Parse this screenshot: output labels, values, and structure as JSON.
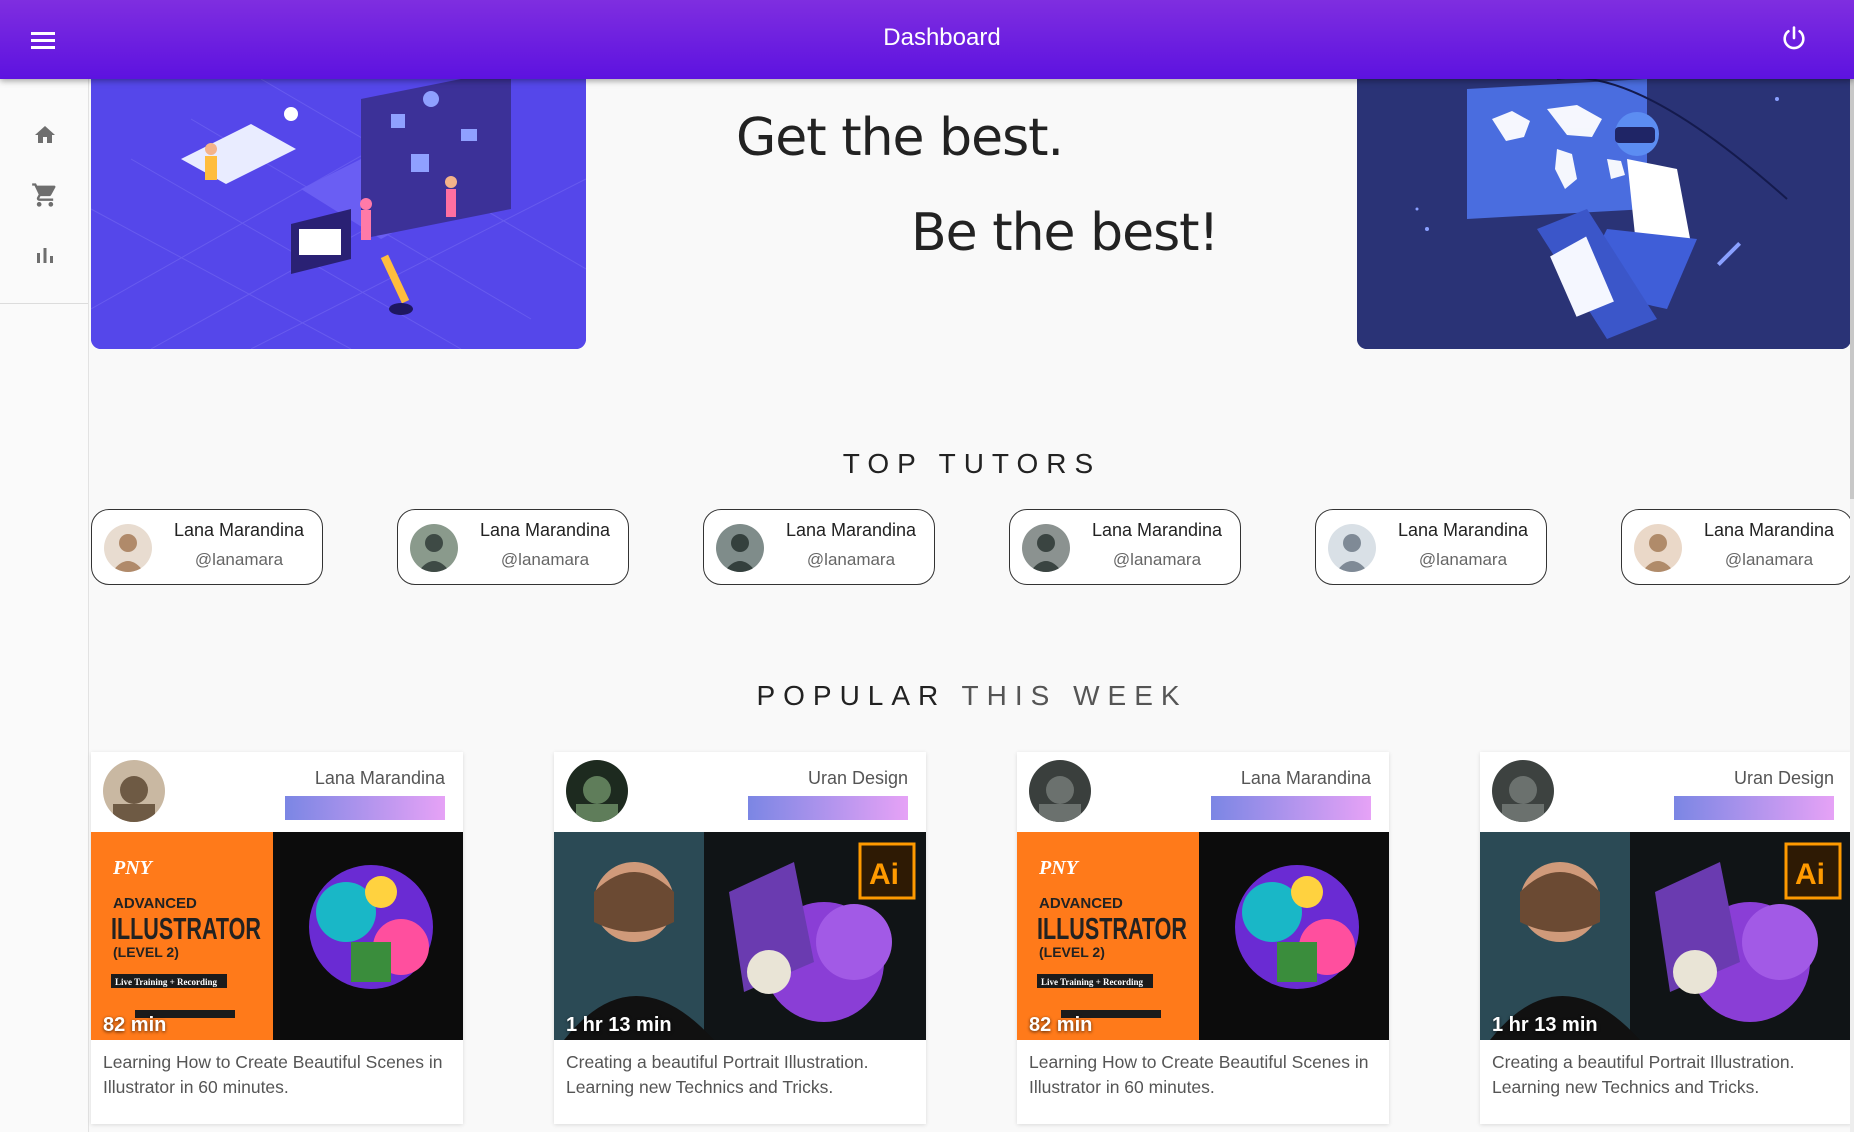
{
  "appbar": {
    "title": "Dashboard"
  },
  "sidebar": {
    "items": [
      {
        "icon": "home-icon"
      },
      {
        "icon": "cart-icon"
      },
      {
        "icon": "bar-chart-icon"
      }
    ]
  },
  "hero": {
    "line1": "Get the best.",
    "line2": "Be the best!"
  },
  "top_tutors": {
    "title": "TOP TUTORS",
    "items": [
      {
        "name": "Lana Marandina",
        "handle": "@lanamara"
      },
      {
        "name": "Lana Marandina",
        "handle": "@lanamara"
      },
      {
        "name": "Lana Marandina",
        "handle": "@lanamara"
      },
      {
        "name": "Lana Marandina",
        "handle": "@lanamara"
      },
      {
        "name": "Lana Marandina",
        "handle": "@lanamara"
      },
      {
        "name": "Lana Marandina",
        "handle": "@lanamara"
      }
    ]
  },
  "popular": {
    "title_bold": "POPULAR",
    "title_light": "THIS WEEK",
    "cards": [
      {
        "author": "Lana Marandina",
        "duration": "82 min",
        "description": "Learning How to Create Beautiful Scenes in Illustrator in 60 minutes.",
        "thumb_heading": "ADVANCED",
        "thumb_big": "ILLUSTRATOR",
        "thumb_level": "(LEVEL 2)",
        "thumb_tag": "Live Training + Recording",
        "thumb_brand": "PNY"
      },
      {
        "author": "Uran Design",
        "duration": "1 hr 13 min",
        "description": "Creating a beautiful Portrait Illustration. Learning new Technics and Tricks.",
        "thumb_badge": "Ai"
      },
      {
        "author": "Lana Marandina",
        "duration": "82 min",
        "description": "Learning How to Create Beautiful Scenes in Illustrator in 60 minutes.",
        "thumb_heading": "ADVANCED",
        "thumb_big": "ILLUSTRATOR",
        "thumb_level": "(LEVEL 2)",
        "thumb_tag": "Live Training + Recording",
        "thumb_brand": "PNY"
      },
      {
        "author": "Uran Design",
        "duration": "1 hr 13 min",
        "description": "Creating a beautiful Portrait Illustration. Learning new Technics and Tricks.",
        "thumb_badge": "Ai"
      }
    ]
  }
}
